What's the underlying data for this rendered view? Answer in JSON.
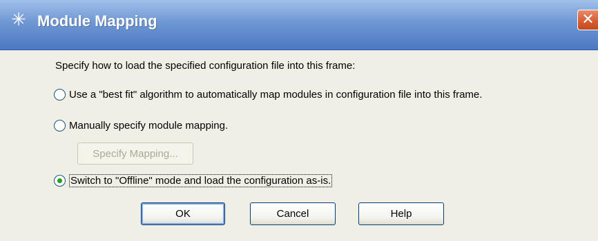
{
  "window": {
    "title": "Module Mapping",
    "icon": "agilent-spark-icon",
    "close_glyph": "✕"
  },
  "dialog": {
    "instruction": "Specify how to load the specified configuration file into this frame:",
    "options": [
      {
        "label": "Use a \"best fit\" algorithm to automatically map modules in configuration file into this frame.",
        "selected": false
      },
      {
        "label": "Manually specify module mapping.",
        "selected": false
      },
      {
        "label": "Switch to \"Offline\" mode and load the configuration as-is.",
        "selected": true
      }
    ],
    "specify_mapping_label": "Specify Mapping...",
    "buttons": {
      "ok": "OK",
      "cancel": "Cancel",
      "help": "Help"
    }
  },
  "colors": {
    "title_bar": "#6f97d3",
    "close_button": "#d6592f",
    "dialog_bg": "#f0efe6",
    "radio_dot": "#21a121"
  }
}
